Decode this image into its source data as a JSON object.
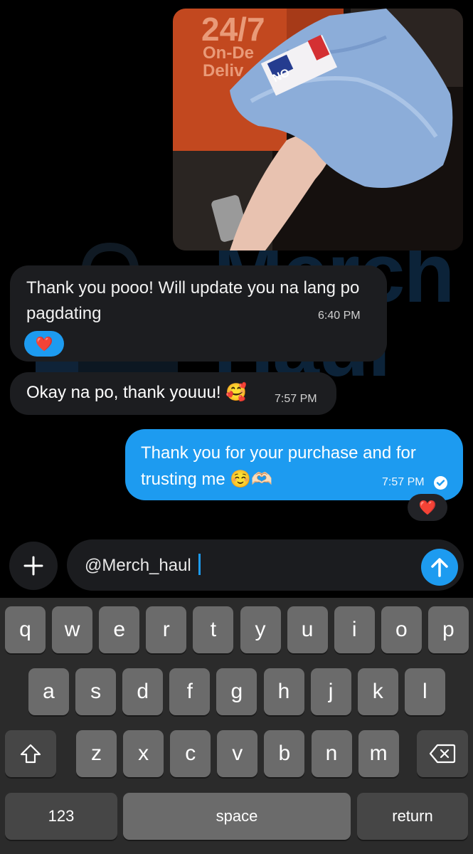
{
  "watermark": {
    "text_line1": "Merch",
    "text_line2": "Haul"
  },
  "photo": {
    "sign_text_1": "24/7",
    "sign_text_2": "On-De",
    "sign_text_3": "Deliv",
    "sticker_text": "NO"
  },
  "messages": {
    "incoming_1": {
      "text": "Thank you pooo! Will update you na lang po pagdating",
      "time": "6:40 PM",
      "reaction": "❤️"
    },
    "incoming_2": {
      "text": "Okay na po, thank youuu! 🥰",
      "time": "7:57 PM"
    },
    "outgoing_1": {
      "text": "Thank you for your purchase and for trusting me ☺️🫶🏻",
      "time": "7:57 PM",
      "reaction": "❤️"
    }
  },
  "composer": {
    "value": "@Merch_haul"
  },
  "keyboard": {
    "row1": [
      "q",
      "w",
      "e",
      "r",
      "t",
      "y",
      "u",
      "i",
      "o",
      "p"
    ],
    "row2": [
      "a",
      "s",
      "d",
      "f",
      "g",
      "h",
      "j",
      "k",
      "l"
    ],
    "row3": [
      "z",
      "x",
      "c",
      "v",
      "b",
      "n",
      "m"
    ],
    "numbers_label": "123",
    "space_label": "space",
    "return_label": "return"
  },
  "colors": {
    "accent": "#1d9bf0",
    "bubble_in": "#1c1d20",
    "keyboard_bg": "#2b2b2b"
  }
}
